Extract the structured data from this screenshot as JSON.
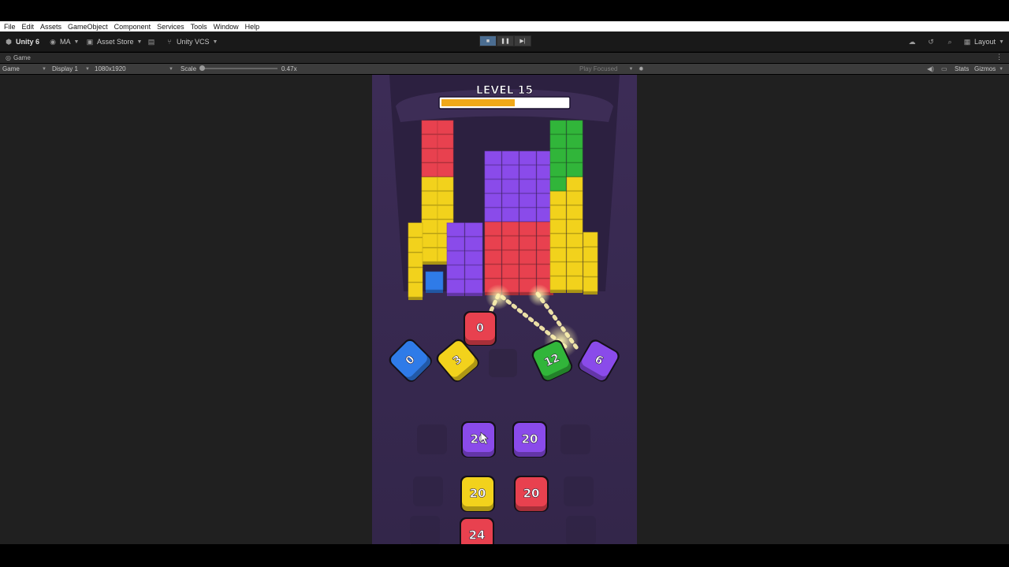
{
  "menubar": {
    "items": [
      "File",
      "Edit",
      "Assets",
      "GameObject",
      "Component",
      "Services",
      "Tools",
      "Window",
      "Help"
    ]
  },
  "toolbar": {
    "unity_label": "Unity 6",
    "account_label": "MA",
    "asset_store_label": "Asset Store",
    "vcs_label": "Unity VCS",
    "layout_label": "Layout"
  },
  "tab": {
    "label": "Game"
  },
  "gamebar": {
    "game_select": "Game",
    "display_select": "Display 1",
    "resolution_select": "1080x1920",
    "scale_label": "Scale",
    "scale_value": "0.47x",
    "play_focused": "Play Focused",
    "stats_label": "Stats",
    "gizmos_label": "Gizmos"
  },
  "game": {
    "level_title": "LEVEL 15",
    "progress": 0.58,
    "shooters": [
      {
        "value": "0",
        "color": "#2f7be8"
      },
      {
        "value": "3",
        "color": "#f2d21c"
      },
      {
        "value": "0",
        "color": "#e8414f"
      },
      {
        "value": "12",
        "color": "#31b53a"
      },
      {
        "value": "6",
        "color": "#8a4bea"
      }
    ],
    "queue_row1": [
      {
        "value": "20",
        "color": "#8a4bea"
      },
      {
        "value": "20",
        "color": "#8a4bea"
      }
    ],
    "queue_row2": [
      {
        "value": "20",
        "color": "#f2d21c"
      },
      {
        "value": "20",
        "color": "#e8414f"
      }
    ],
    "queue_row3": [
      {
        "value": "24",
        "color": "#e8414f"
      }
    ]
  },
  "colors": {
    "red": "#e8414f",
    "yellow": "#f2d21c",
    "purple": "#8a4bea",
    "green": "#31b53a",
    "blue": "#2f7be8",
    "progress_fill": "#f0a819"
  }
}
